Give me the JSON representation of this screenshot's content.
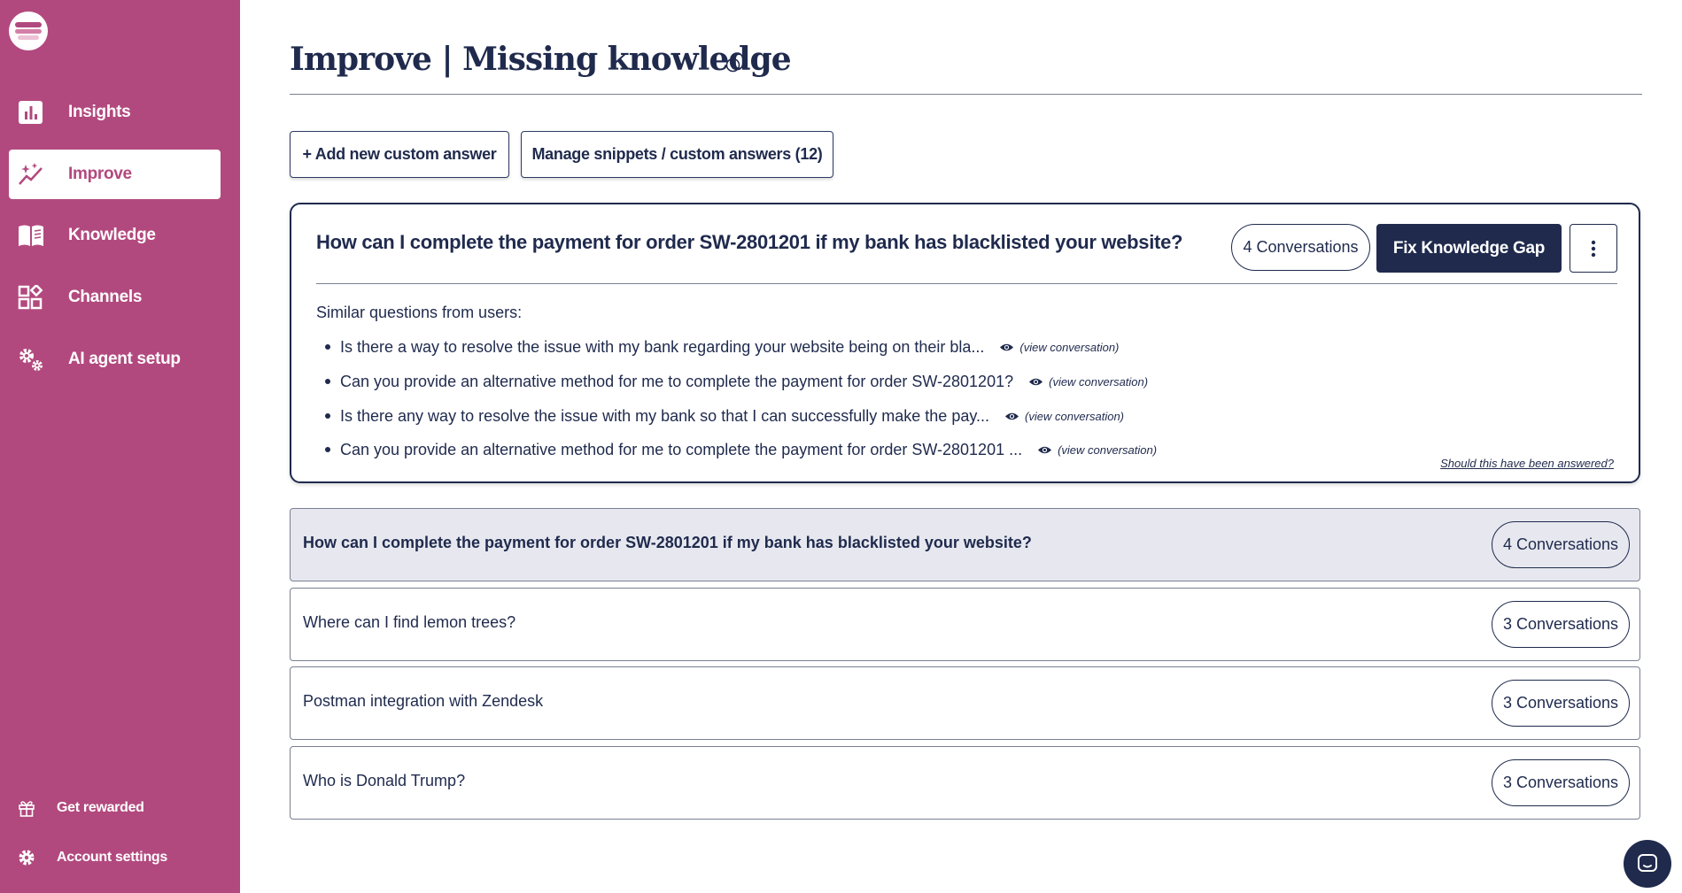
{
  "sidebar": {
    "logo": "app-logo",
    "items": [
      {
        "label": "Insights",
        "icon": "bar-chart-icon",
        "active": false
      },
      {
        "label": "Improve",
        "icon": "sparkle-trend-icon",
        "active": true
      },
      {
        "label": "Knowledge",
        "icon": "book-icon",
        "active": false
      },
      {
        "label": "Channels",
        "icon": "grid-plus-icon",
        "active": false
      },
      {
        "label": "AI agent setup",
        "icon": "gears-icon",
        "active": false
      }
    ],
    "bottom": [
      {
        "label": "Get rewarded",
        "icon": "gift-icon"
      },
      {
        "label": "Account settings",
        "icon": "gear-icon"
      }
    ]
  },
  "header": {
    "title": "Improve | Missing knowledge"
  },
  "actions": {
    "add_label": "+ Add new custom answer",
    "manage_label": "Manage snippets / custom answers (12)"
  },
  "expanded": {
    "question": "How can I complete the payment for order SW-2801201 if my bank has blacklisted your website?",
    "conversations": "4 Conversations",
    "fix_label": "Fix Knowledge Gap",
    "similar_label": "Similar questions from users:",
    "similar": [
      "Is there a way to resolve the issue with my bank regarding your website being on their bla...",
      "Can you provide an alternative method for me to complete the payment for order SW-2801201?",
      "Is there any way to resolve the issue with my bank so that I can successfully make the pay...",
      "Can you provide an alternative method for me to complete the payment for order SW-2801201 ..."
    ],
    "view_link": "(view conversation)",
    "should_link": "Should this have been answered?"
  },
  "questions": [
    {
      "text": "How can I complete the payment for order SW-2801201 if my bank has blacklisted your website?",
      "count": "4 Conversations",
      "active": true
    },
    {
      "text": "Where can I find lemon trees?",
      "count": "3 Conversations",
      "active": false
    },
    {
      "text": "Postman integration with Zendesk",
      "count": "3 Conversations",
      "active": false
    },
    {
      "text": "Who is Donald Trump?",
      "count": "3 Conversations",
      "active": false
    }
  ],
  "colors": {
    "sidebar": "#b2497e",
    "navy": "#1f2a4d",
    "active_row": "#e7e8ef"
  }
}
